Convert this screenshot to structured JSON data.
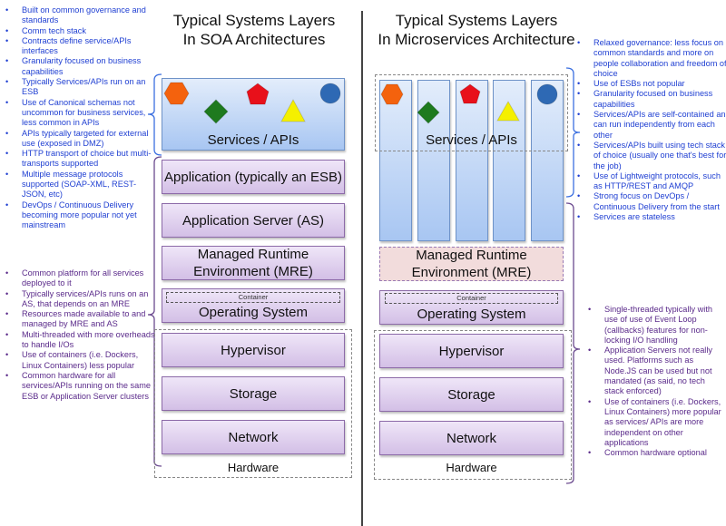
{
  "soa": {
    "title_line1": "Typical Systems Layers",
    "title_line2": "In SOA Architectures",
    "services_label": "Services / APIs",
    "layers": [
      {
        "label": "Application (typically an ESB)"
      },
      {
        "label": "Application Server (AS)"
      },
      {
        "label": "Managed Runtime Environment (MRE)"
      },
      {
        "label": "Operating System",
        "container_label": "Container"
      },
      {
        "label": "Hypervisor"
      },
      {
        "label": "Storage"
      },
      {
        "label": "Network"
      }
    ],
    "hardware_label": "Hardware",
    "notes_top": [
      "Built on common governance and standards",
      "Comm tech stack",
      "Contracts define service/APIs interfaces",
      "Granularity focused on business capabilities",
      "Typically Services/APIs run on an ESB",
      "Use of Canonical schemas not uncommon for business services, less common in APIs",
      "APIs typically targeted for external use (exposed in DMZ)",
      "HTTP transport of choice but multi-transports supported",
      "Multiple message protocols supported (SOAP-XML, REST-JSON, etc)",
      "DevOps / Continuous Delivery becoming more popular not yet mainstream"
    ],
    "notes_bottom": [
      "Common platform for all services deployed to it",
      "Typically services/APIs runs on an AS, that depends on an MRE",
      "Resources made available to and managed by MRE and AS",
      "Multi-threaded with more overheads to handle I/Os",
      "Use of containers (i.e. Dockers, Linux Containers) less popular",
      "Common hardware for all services/APIs running on the same ESB or Application Server clusters"
    ]
  },
  "micro": {
    "title_line1": "Typical Systems Layers",
    "title_line2": "In Microservices Architecture",
    "services_label": "Services / APIs",
    "layers": [
      {
        "label": "Managed Runtime Environment (MRE)"
      },
      {
        "label": "Operating System",
        "container_label": "Container"
      },
      {
        "label": "Hypervisor"
      },
      {
        "label": "Storage"
      },
      {
        "label": "Network"
      }
    ],
    "hardware_label": "Hardware",
    "notes_top": [
      "Relaxed governance: less focus on common standards and more on people collaboration and freedom of choice",
      "Use of ESBs not popular",
      "Granularity focused on business capabilities",
      "Services/APIs are self-contained an can run independently from each other",
      "Services/APIs built using tech stack of choice (usually one that's best for the job)",
      "Use of Lightweight protocols, such as HTTP/REST and AMQP",
      "Strong focus on DevOps / Continuous Delivery from the start",
      "Services are stateless"
    ],
    "notes_bottom": [
      "Single-threaded typically with use of use of Event Loop (callbacks) features for non-locking I/O handling",
      "Application Servers not really used. Platforms such as Node.JS can be used but not mandated (as said, no tech stack enforced)",
      "Use of containers (i.e. Dockers, Linux Containers) more popular as services/ APIs are more independent on other applications",
      "Common hardware optional"
    ]
  },
  "shapes": [
    {
      "name": "hexagon",
      "color": "#f4620d"
    },
    {
      "name": "diamond",
      "color": "#1e7a1e"
    },
    {
      "name": "pentagon",
      "color": "#e8101a"
    },
    {
      "name": "triangle",
      "color": "#f5f000"
    },
    {
      "name": "circle",
      "color": "#2e69b4"
    }
  ],
  "colors": {
    "note_blue": "#1f3fd2",
    "note_purple": "#5a2a8a",
    "bracket_blue": "#3b6fe0",
    "bracket_purple": "#6b4a8f"
  }
}
